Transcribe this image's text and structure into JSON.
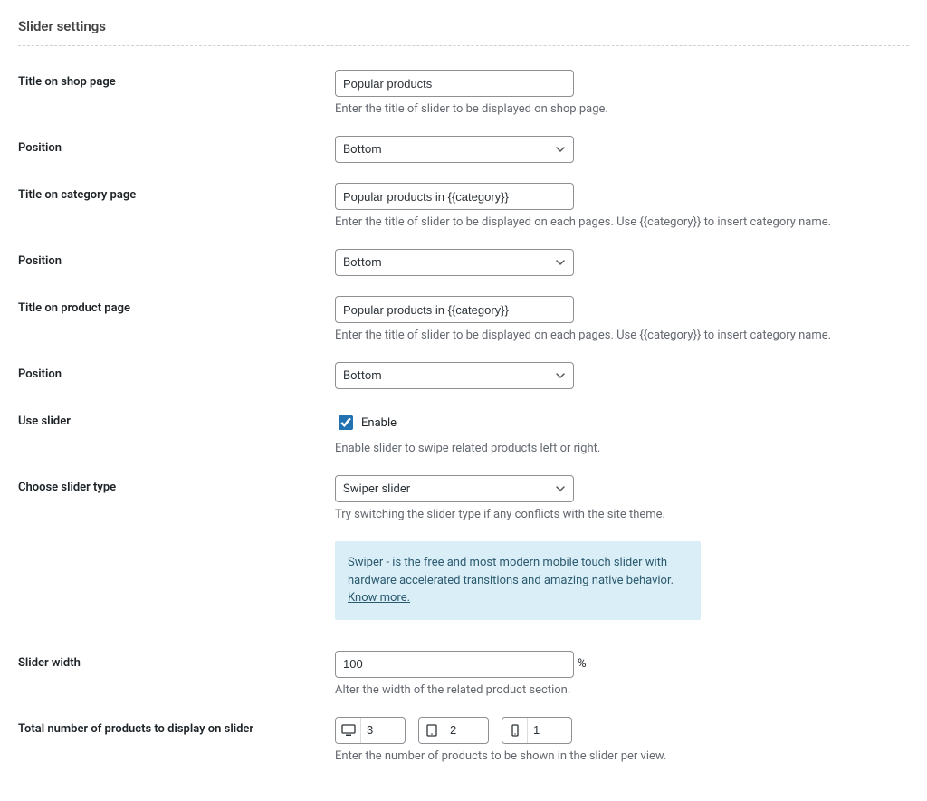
{
  "section_title": "Slider settings",
  "fields": {
    "title_shop": {
      "label": "Title on shop page",
      "value": "Popular products",
      "desc": "Enter the title of slider to be displayed on shop page."
    },
    "position1": {
      "label": "Position",
      "value": "Bottom"
    },
    "title_category": {
      "label": "Title on category page",
      "value": "Popular products in {{category}}",
      "desc": "Enter the title of slider to be displayed on each pages. Use {{category}} to insert category name."
    },
    "position2": {
      "label": "Position",
      "value": "Bottom"
    },
    "title_product": {
      "label": "Title on product page",
      "value": "Popular products in {{category}}",
      "desc": "Enter the title of slider to be displayed on each pages. Use {{category}} to insert category name."
    },
    "position3": {
      "label": "Position",
      "value": "Bottom"
    },
    "use_slider": {
      "label": "Use slider",
      "cb_label": "Enable",
      "desc": "Enable slider to swipe related products left or right."
    },
    "slider_type": {
      "label": "Choose slider type",
      "value": "Swiper slider",
      "desc": "Try switching the slider type if any conflicts with the site theme."
    },
    "info": {
      "text": "Swiper - is the free and most modern mobile touch slider with hardware accelerated transitions and amazing native behavior. ",
      "link": "Know more."
    },
    "slider_width": {
      "label": "Slider width",
      "value": "100",
      "suffix": "%",
      "desc": "Alter the width of the related product section."
    },
    "products_count": {
      "label": "Total number of products to display on slider",
      "desktop": "3",
      "tablet": "2",
      "mobile": "1",
      "desc": "Enter the number of products to be shown in the slider per view."
    }
  }
}
